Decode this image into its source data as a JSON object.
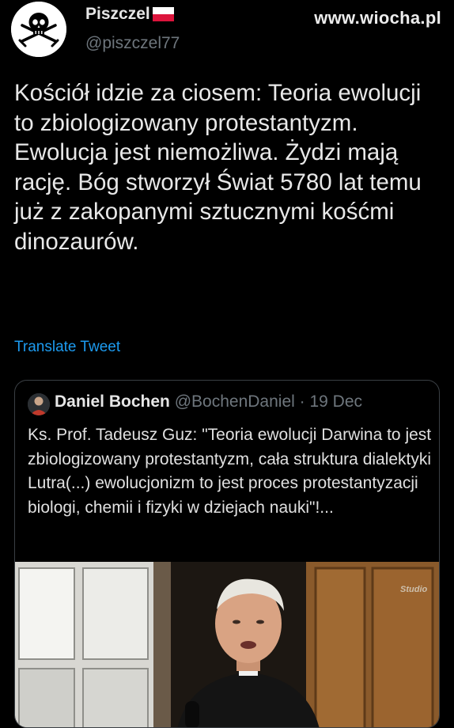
{
  "tweet": {
    "author_name": "Piszczel",
    "author_handle": "@piszczel77",
    "text": "Kościół idzie za ciosem: Teoria ewolucji to zbiologizowany protestantyzm. Ewolucja jest niemożliwa. Żydzi mają rację. Bóg stworzył Świat 5780 lat temu już z zakopanymi sztucznymi kośćmi dinozaurów.",
    "translate_label": "Translate Tweet"
  },
  "watermark": "www.wiocha.pl",
  "quoted_tweet": {
    "author_name": "Daniel Bochen",
    "author_handle": "@BochenDaniel",
    "separator": "·",
    "date": "19 Dec",
    "text": "Ks. Prof. Tadeusz Guz: \"Teoria ewolucji Darwina to jest zbiologizowany protestantyzm, cała struktura dialektyki Lutra(...) ewolucjonizm to jest proces protestantyzacji biologi, chemii i fizyki w dziejach nauki\"!...",
    "media_logo": "Studio"
  },
  "icons": {
    "author_avatar": "jolly-roger-icon",
    "author_flag": "poland-flag-icon"
  },
  "colors": {
    "background": "#000000",
    "link": "#1d9bf0",
    "secondary_text": "#6e767d",
    "border": "#3a3f44",
    "flag_red": "#dc143c"
  }
}
